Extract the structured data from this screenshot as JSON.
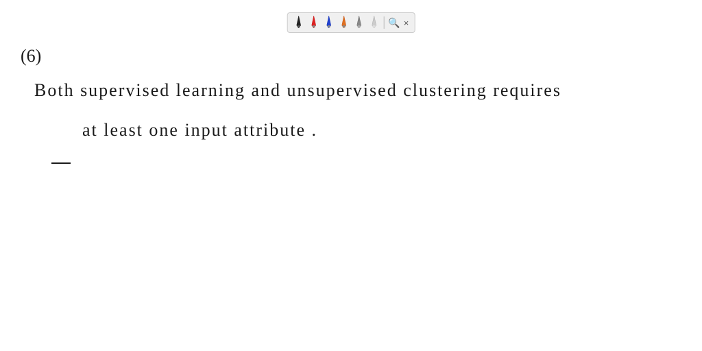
{
  "toolbar": {
    "tools": [
      {
        "name": "pen-black",
        "symbol": "✏",
        "color": "#222"
      },
      {
        "name": "pen-red",
        "symbol": "✏",
        "color": "#e02020"
      },
      {
        "name": "pen-blue",
        "symbol": "✏",
        "color": "#2040d0"
      },
      {
        "name": "pen-orange",
        "symbol": "✏",
        "color": "#e07020"
      },
      {
        "name": "pen-gray",
        "symbol": "✏",
        "color": "#888"
      },
      {
        "name": "pen-lightgray",
        "symbol": "✏",
        "color": "#bbb"
      }
    ],
    "search_icon": "🔍",
    "close_label": "×"
  },
  "content": {
    "number_label": "(6)",
    "line1": "Both supervised learning and unsupervised clustering requires",
    "line2": "at least  one  input       attribute ."
  }
}
